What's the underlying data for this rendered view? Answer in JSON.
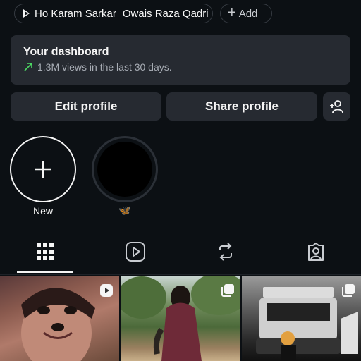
{
  "music_chip": {
    "song_title": "Ho Karam Sarkar",
    "artist": "Owais Raza Qadri",
    "icon": "play-icon"
  },
  "add_chip": {
    "label": "Add",
    "icon": "plus-icon"
  },
  "dashboard": {
    "title": "Your dashboard",
    "subtitle": "1.3M views in the last 30 days.",
    "trend_color": "#4cd964",
    "icon": "trend-up-arrow-icon"
  },
  "buttons": {
    "edit_profile": "Edit profile",
    "share_profile": "Share profile",
    "add_person_icon": "add-person-icon"
  },
  "highlights": [
    {
      "label": "New",
      "icon": "plus-icon"
    },
    {
      "label": "🦋"
    }
  ],
  "tabs": [
    {
      "icon": "grid-icon",
      "selected": true
    },
    {
      "icon": "reels-icon",
      "selected": false
    },
    {
      "icon": "repost-icon",
      "selected": false
    },
    {
      "icon": "tagged-icon",
      "selected": false
    }
  ],
  "posts": [
    {
      "badge": "reel-icon"
    },
    {
      "badge": "multiple-posts-icon"
    },
    {
      "badge": "multiple-posts-icon"
    }
  ],
  "colors": {
    "background": "#0c1014",
    "card": "#262a31",
    "text": "#f5f5f5",
    "muted": "#a8adb5"
  }
}
